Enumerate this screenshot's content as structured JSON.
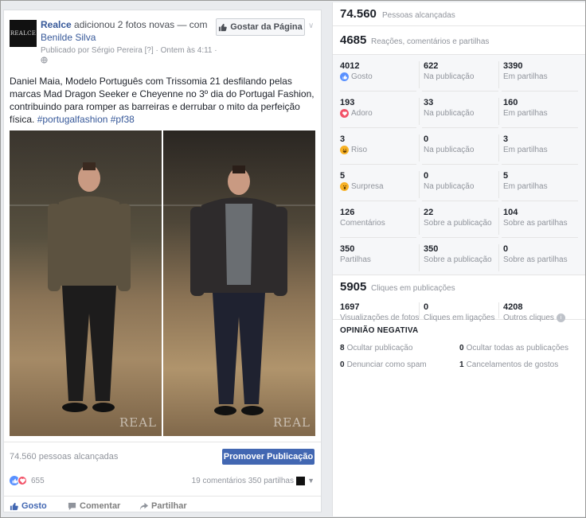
{
  "post": {
    "page_name": "Realce",
    "headline_mid": " adicionou 2 fotos novas — com ",
    "tagged_user": "Benilde Silva",
    "logo_text": "REALCE",
    "meta_line1": "Publicado por Sérgio Pereira [?] · Ontem às 4:11 ·",
    "like_page_label": "Gostar da Página",
    "caption_text": "Daniel Maia, Modelo Português com Trissomia 21 desfilando pelas marcas Mad Dragon Seeker e Cheyenne no 3º dia do Portugal Fashion, contribuindo para romper as barreiras e derrubar o mito da perfeição física. ",
    "caption_tags": "#portugalfashion #pf38",
    "watermark_1": "REAL",
    "watermark_2": "REAL",
    "reach_text": "74.560 pessoas alcançadas",
    "promote_label": "Promover Publicação",
    "reaction_count": "655",
    "comments_shares": "19 comentários   350 partilhas",
    "action_like": "Gosto",
    "action_comment": "Comentar",
    "action_share": "Partilhar"
  },
  "insights": {
    "reached_num": "74.560",
    "reached_lbl": "Pessoas alcançadas",
    "reactions_num": "4685",
    "reactions_lbl": "Reações, comentários e partilhas",
    "rows": [
      {
        "a": {
          "num": "4012",
          "lbl": "Gosto"
        },
        "b": {
          "num": "622",
          "lbl": "Na publicação"
        },
        "c": {
          "num": "3390",
          "lbl": "Em partilhas"
        }
      },
      {
        "a": {
          "num": "193",
          "lbl": "Adoro"
        },
        "b": {
          "num": "33",
          "lbl": "Na publicação"
        },
        "c": {
          "num": "160",
          "lbl": "Em partilhas"
        }
      },
      {
        "a": {
          "num": "3",
          "lbl": "Riso"
        },
        "b": {
          "num": "0",
          "lbl": "Na publicação"
        },
        "c": {
          "num": "3",
          "lbl": "Em partilhas"
        }
      },
      {
        "a": {
          "num": "5",
          "lbl": "Surpresa"
        },
        "b": {
          "num": "0",
          "lbl": "Na publicação"
        },
        "c": {
          "num": "5",
          "lbl": "Em partilhas"
        }
      },
      {
        "a": {
          "num": "126",
          "lbl": "Comentários"
        },
        "b": {
          "num": "22",
          "lbl": "Sobre a publicação"
        },
        "c": {
          "num": "104",
          "lbl": "Sobre as partilhas"
        }
      },
      {
        "a": {
          "num": "350",
          "lbl": "Partilhas"
        },
        "b": {
          "num": "350",
          "lbl": "Sobre a publicação"
        },
        "c": {
          "num": "0",
          "lbl": "Sobre as partilhas"
        }
      }
    ],
    "clicks_num": "5905",
    "clicks_lbl": "Cliques em publicações",
    "clicks": {
      "a": {
        "num": "1697",
        "lbl": "Visualizações de fotos"
      },
      "b": {
        "num": "0",
        "lbl": "Cliques em ligações"
      },
      "c": {
        "num": "4208",
        "lbl": "Outros cliques"
      }
    },
    "negative_title": "OPINIÃO NEGATIVA",
    "negative": [
      {
        "num": "8",
        "lbl": "Ocultar publicação"
      },
      {
        "num": "0",
        "lbl": "Ocultar todas as publicações"
      },
      {
        "num": "0",
        "lbl": "Denunciar como spam"
      },
      {
        "num": "1",
        "lbl": "Cancelamentos de gostos"
      }
    ]
  },
  "colors": {
    "brand": "#4267b2",
    "link": "#365899",
    "like": "#5890ff",
    "love": "#f25268",
    "haha": "#f7b125"
  }
}
